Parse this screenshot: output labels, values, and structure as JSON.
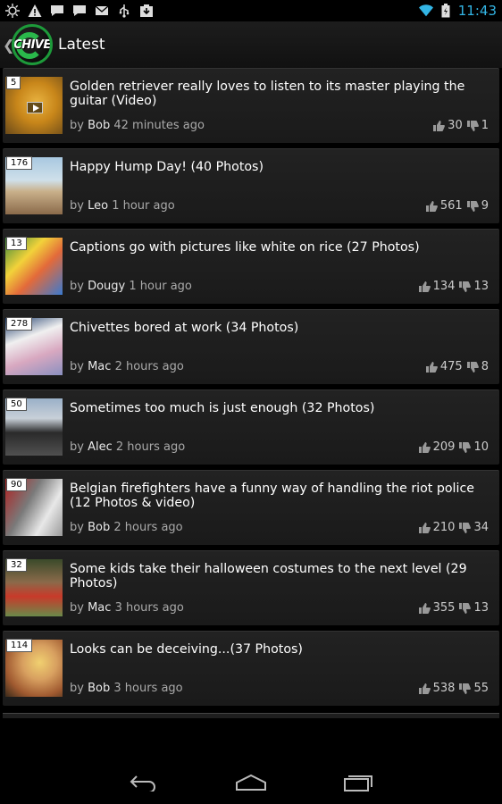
{
  "status_bar": {
    "time": "11:43",
    "icons_left": [
      "brightness-icon",
      "alert-icon",
      "chat-icon",
      "chat-icon",
      "gmail-icon",
      "usb-icon",
      "download-icon"
    ],
    "icons_right": [
      "wifi-icon",
      "battery-charging-icon"
    ],
    "accent_color": "#33b5e5"
  },
  "action_bar": {
    "logo_text": "CHIVE",
    "title": "Latest"
  },
  "posts": [
    {
      "count": "5",
      "title": "Golden retriever really loves to listen to its master playing the guitar (Video)",
      "by": "by",
      "author": "Bob",
      "time": "42 minutes ago",
      "up": "30",
      "down": "1",
      "video": true
    },
    {
      "count": "176",
      "title": "Happy Hump Day! (40 Photos)",
      "by": "by",
      "author": "Leo",
      "time": "1 hour ago",
      "up": "561",
      "down": "9"
    },
    {
      "count": "13",
      "title": "Captions go with pictures like white on rice (27 Photos)",
      "by": "by",
      "author": "Dougy",
      "time": "1 hour ago",
      "up": "134",
      "down": "13"
    },
    {
      "count": "278",
      "title": "Chivettes bored at work (34 Photos)",
      "by": "by",
      "author": "Mac",
      "time": "2 hours ago",
      "up": "475",
      "down": "8"
    },
    {
      "count": "50",
      "title": "Sometimes too much is just enough (32 Photos)",
      "by": "by",
      "author": "Alec",
      "time": "2 hours ago",
      "up": "209",
      "down": "10"
    },
    {
      "count": "90",
      "title": "Belgian firefighters have a funny way of handling the riot police (12 Photos & video)",
      "by": "by",
      "author": "Bob",
      "time": "2 hours ago",
      "up": "210",
      "down": "34"
    },
    {
      "count": "32",
      "title": "Some kids take their halloween costumes to the next level (29 Photos)",
      "by": "by",
      "author": "Mac",
      "time": "3 hours ago",
      "up": "355",
      "down": "13"
    },
    {
      "count": "114",
      "title": "Looks can be deceiving...(37 Photos)",
      "by": "by",
      "author": "Bob",
      "time": "3 hours ago",
      "up": "538",
      "down": "55"
    }
  ],
  "nav_bar": {
    "buttons": [
      "back-icon",
      "home-icon",
      "recent-apps-icon"
    ]
  }
}
